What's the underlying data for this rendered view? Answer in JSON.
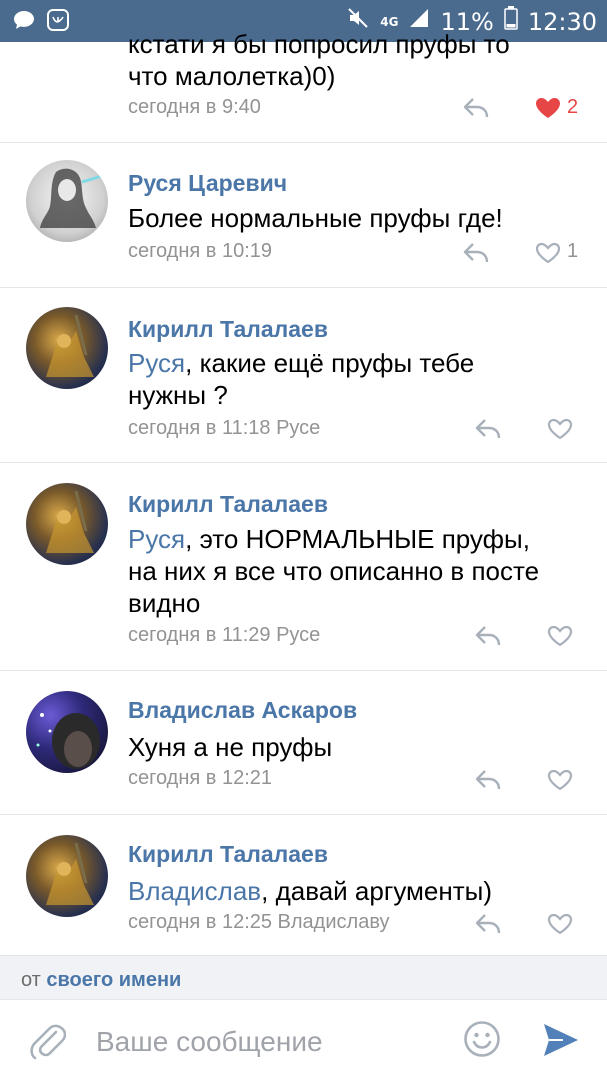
{
  "status_bar": {
    "network": "4G",
    "battery": "11%",
    "time": "12:30",
    "bg_color": "#4a6a8e"
  },
  "comments": [
    {
      "author": "",
      "text": "кстати я бы попросил пруфы то что малолетка)0)",
      "text_line1": "кстати я бы попросил пруфы то",
      "text_line2": "что малолетка)0)",
      "time": "сегодня в 9:40",
      "likes": "2",
      "liked": true
    },
    {
      "author": "Руся Царевич",
      "text": "Более нормальные пруфы где!",
      "time": "сегодня в 10:19",
      "likes": "1",
      "liked": false
    },
    {
      "author": "Кирилл Талалаев",
      "mention": "Руся",
      "text_rest": ", какие ещё пруфы тебе",
      "text_line2": "нужны ?",
      "time": "сегодня в 11:18 Русе",
      "likes": "",
      "liked": false
    },
    {
      "author": "Кирилл Талалаев",
      "mention": "Руся",
      "text_rest": ", это НОРМАЛЬНЫЕ пруфы,",
      "text_line2": "на них я все что описанно в посте",
      "text_line3": "видно",
      "time": "сегодня в 11:29 Русе",
      "likes": "",
      "liked": false
    },
    {
      "author": "Владислав Аскаров",
      "text": "Хуня а не пруфы",
      "time": "сегодня в 12:21",
      "likes": "",
      "liked": false
    },
    {
      "author": "Кирилл Талалаев",
      "mention": "Владислав",
      "text_rest": ", давай аргументы)",
      "time": "сегодня в 12:25 Владиславу",
      "likes": "",
      "liked": false
    }
  ],
  "footer": {
    "from_prefix": "от",
    "from_link": "своего имени",
    "input_placeholder": "Ваше сообщение"
  },
  "colors": {
    "link": "#4a76a8",
    "meta": "#939393",
    "like_active": "#e64646",
    "icon": "#a8b0ba",
    "send": "#5181b8"
  },
  "icons": [
    "chat-icon",
    "vk-icon",
    "mute-icon",
    "signal-icon",
    "battery-icon",
    "reply-icon",
    "heart-icon",
    "attach-icon",
    "emoji-icon",
    "send-icon"
  ]
}
